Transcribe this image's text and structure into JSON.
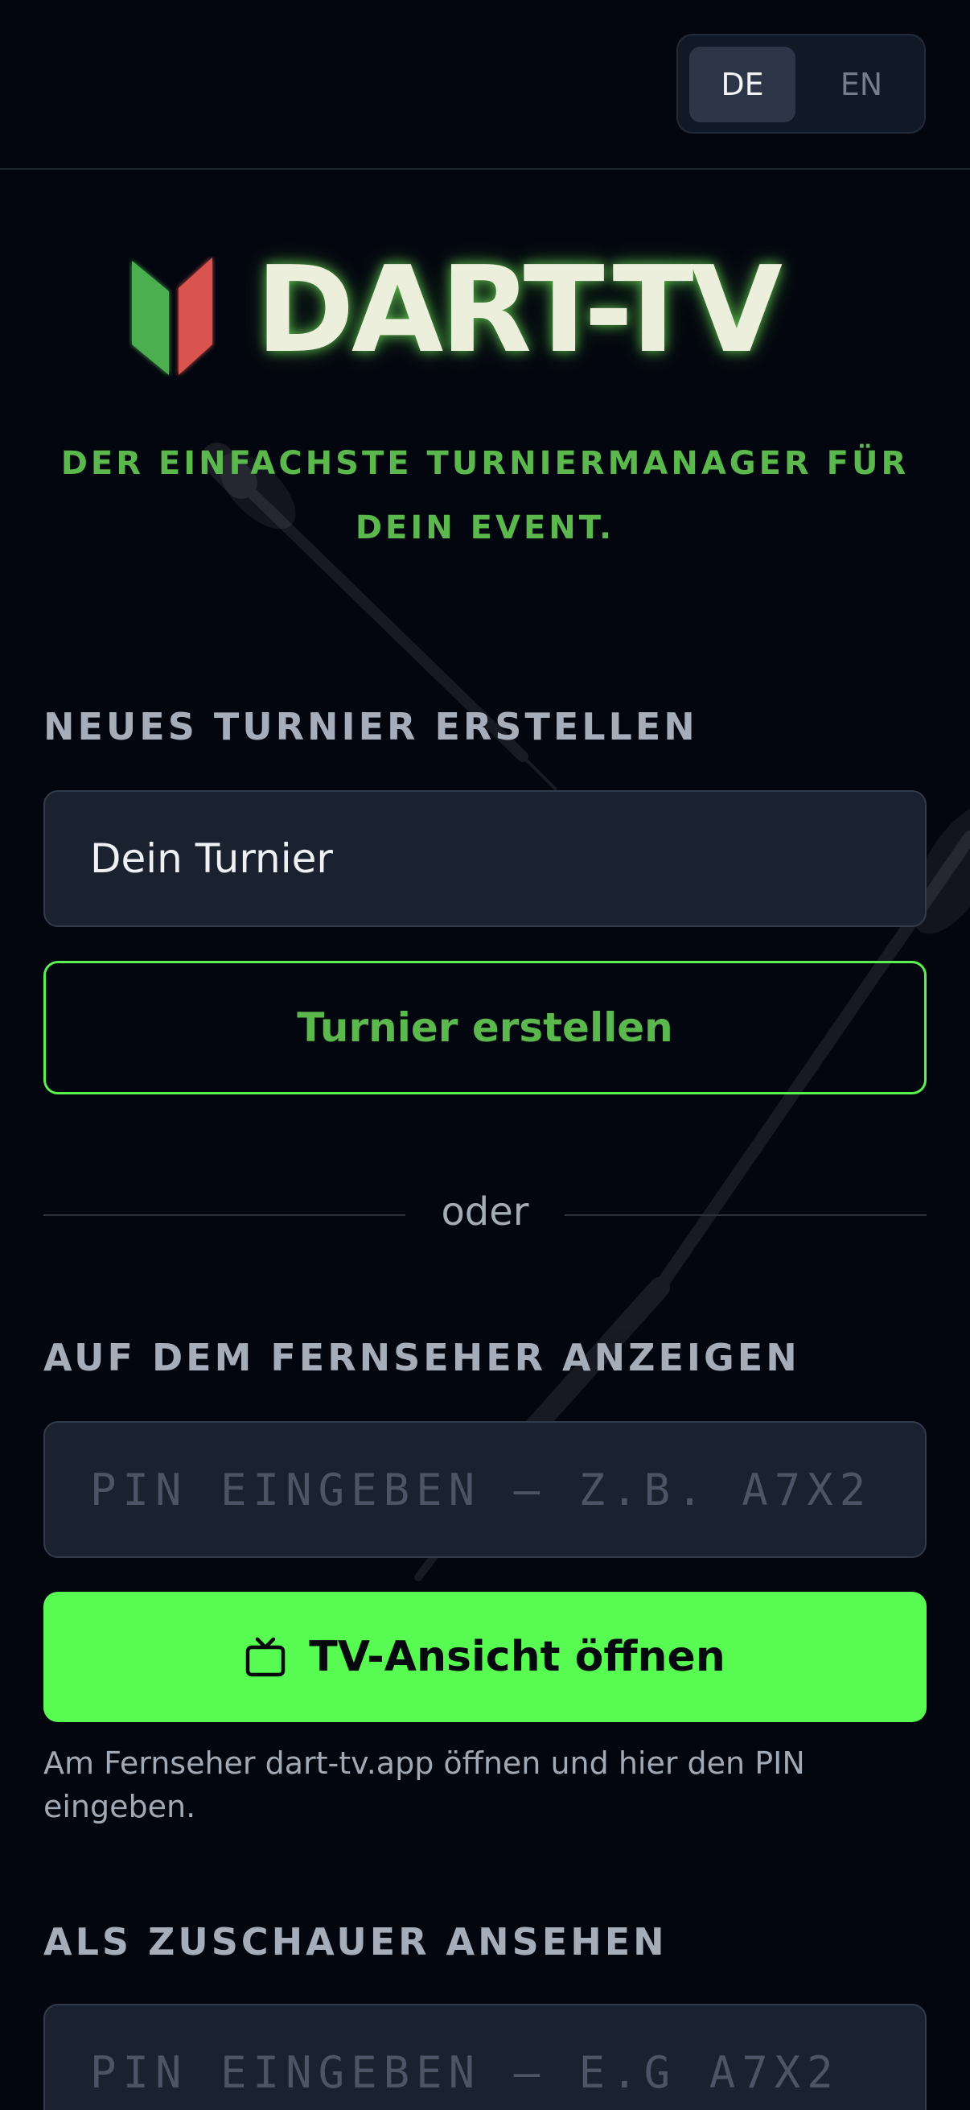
{
  "header": {
    "languages": [
      {
        "label": "DE",
        "active": true
      },
      {
        "label": "EN",
        "active": false
      }
    ]
  },
  "brand": {
    "name": "DART-TV",
    "tagline_line1": "DER EINFACHSTE TURNIERMANAGER FÜR",
    "tagline_line2": "DEIN EVENT.",
    "colors": {
      "green": "#4caf50",
      "red": "#d9534f",
      "accent": "#58fb52"
    }
  },
  "create_section": {
    "heading": "NEUES TURNIER ERSTELLEN",
    "input_value": "Dein Turnier",
    "button_label": "Turnier erstellen"
  },
  "separator": {
    "label": "oder"
  },
  "tv_section": {
    "heading": "AUF DEM FERNSEHER ANZEIGEN",
    "pin_placeholder": "PIN EINGEBEN — Z.B. A7X2",
    "button_icon": "tv-icon",
    "button_label": "TV-Ansicht öffnen",
    "hint": "Am Fernseher dart-tv.app öffnen und hier den PIN eingeben."
  },
  "viewer_section": {
    "heading": "ALS ZUSCHAUER ANSEHEN",
    "pin_placeholder": "PIN EINGEBEN — E.G A7X2"
  }
}
